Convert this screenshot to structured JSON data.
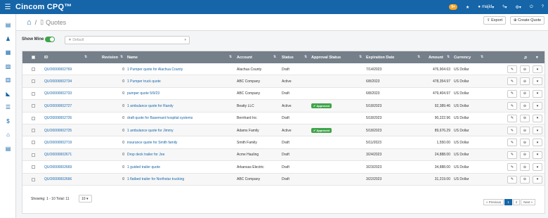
{
  "app": {
    "brand": "Cincom CPQ™",
    "notif_count": "9+",
    "user": "majid",
    "menu_chevron": "▾"
  },
  "header": {
    "title": "Quotes",
    "export_label": "Export",
    "create_label": "Create Quote"
  },
  "filters": {
    "show_mine_label": "Show Mine",
    "show_mine_on": true,
    "view_value": "Default"
  },
  "table": {
    "columns": [
      "ID",
      "Revision",
      "Name",
      "Account",
      "Status",
      "Approval Status",
      "Expiration Date",
      "Amount",
      "Currency"
    ],
    "rows": [
      {
        "id": "QUO0000002769",
        "revision": "0",
        "name": "1 Pumper quote for Alachua County",
        "account": "Alachua County",
        "status": "Draft",
        "approval": "",
        "expiration": "7/14/2023",
        "amount": "476,904.63",
        "currency": "US Dollar"
      },
      {
        "id": "QUO0000002734",
        "revision": "0",
        "name": "1 Pumper truck quote",
        "account": "ABC Company",
        "status": "Active",
        "approval": "",
        "expiration": "6/8/2023",
        "amount": "478,354.97",
        "currency": "US Dollar"
      },
      {
        "id": "QUO0000002733",
        "revision": "0",
        "name": "pumper quote 5/9/23",
        "account": "ABC Company",
        "status": "Draft",
        "approval": "",
        "expiration": "6/8/2023",
        "amount": "479,404.97",
        "currency": "US Dollar"
      },
      {
        "id": "QUO0000002727",
        "revision": "0",
        "name": "1 ambulance quote for Randy",
        "account": "Beatty LLC",
        "status": "Active",
        "approval": "Approved",
        "expiration": "5/18/2023",
        "amount": "92,389.46",
        "currency": "US Dollar"
      },
      {
        "id": "QUO0000002726",
        "revision": "0",
        "name": "draft quote for Basemant hospital systems",
        "account": "Bernhard Inc",
        "status": "Draft",
        "approval": "",
        "expiration": "5/18/2023",
        "amount": "90,222.96",
        "currency": "US Dollar"
      },
      {
        "id": "QUO0000002725",
        "revision": "0",
        "name": "1 ambulance quote for Jimmy",
        "account": "Adams Family",
        "status": "Active",
        "approval": "Approved",
        "expiration": "5/18/2023",
        "amount": "89,676.29",
        "currency": "US Dollar"
      },
      {
        "id": "QUO0000002719",
        "revision": "0",
        "name": "insurance quote for Smith family",
        "account": "Smith Family",
        "status": "Draft",
        "approval": "",
        "expiration": "5/11/2023",
        "amount": "1,550.00",
        "currency": "US Dollar"
      },
      {
        "id": "QUO0000002671",
        "revision": "0",
        "name": "Drop deck trailer for Joe",
        "account": "Acme Hauling",
        "status": "Draft",
        "approval": "",
        "expiration": "3/24/2023",
        "amount": "24,888.00",
        "currency": "US Dollar"
      },
      {
        "id": "QUO0000002669",
        "revision": "0",
        "name": "1 guided trailer quote",
        "account": "Arkansas Electric",
        "status": "Draft",
        "approval": "",
        "expiration": "3/23/2023",
        "amount": "34,888.00",
        "currency": "US Dollar"
      },
      {
        "id": "QUO0000002666",
        "revision": "0",
        "name": "1 flatbed trailer for Northstar trucking",
        "account": "ABC Company",
        "status": "Draft",
        "approval": "",
        "expiration": "3/22/2023",
        "amount": "31,219.00",
        "currency": "US Dollar"
      }
    ]
  },
  "footer": {
    "showing": "Showing: 1 - 10 Total: 11",
    "per_page": "10",
    "prev_label": "« Previous",
    "pages": [
      "1",
      "2"
    ],
    "next_label": "Next »"
  },
  "icons": {
    "accent": "#1565a8",
    "approved_color": "#3fa44a",
    "sidebar": [
      "book-icon",
      "users-icon",
      "grid-icon",
      "chart-icon",
      "document-icon",
      "megaphone-icon",
      "list-icon",
      "dollar-icon",
      "bank-icon",
      "form-icon"
    ]
  }
}
